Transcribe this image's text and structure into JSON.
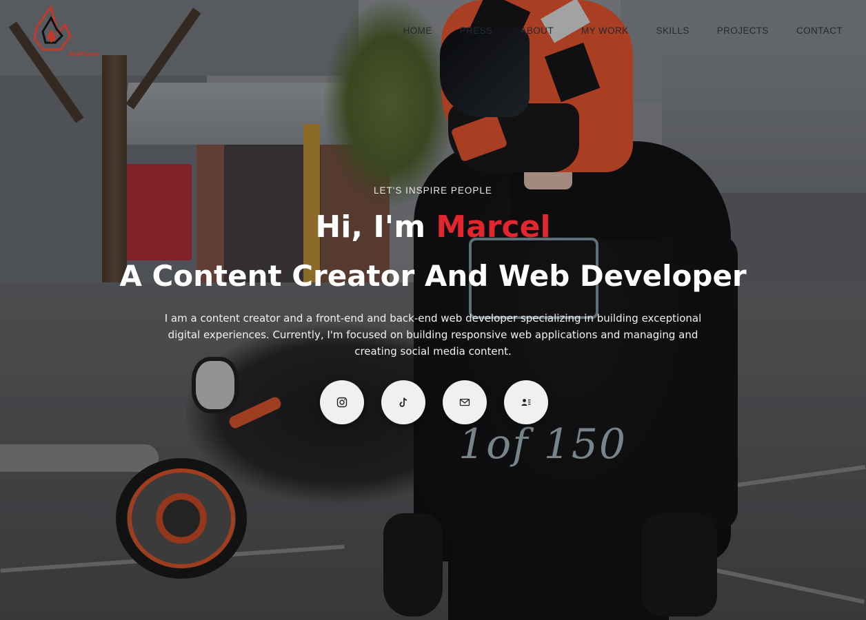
{
  "brand": {
    "logo_text": "RedFlame"
  },
  "nav": {
    "items": [
      {
        "label": "HOME"
      },
      {
        "label": "PRESS"
      },
      {
        "label": "ABOUT"
      },
      {
        "label": "MY WORK"
      },
      {
        "label": "SKILLS"
      },
      {
        "label": "PROJECTS"
      },
      {
        "label": "CONTACT"
      }
    ]
  },
  "hero": {
    "eyebrow": "LET'S INSPIRE PEOPLE",
    "greeting": "Hi, I'm ",
    "name": "Marcel",
    "role": "A Content Creator And Web Developer",
    "bio": "I am a content creator and a front-end and back-end web developer specializing in building exceptional digital experiences. Currently, I'm focused on building responsive web applications and managing and creating social media content."
  },
  "social": [
    {
      "icon": "instagram-icon"
    },
    {
      "icon": "tiktok-icon"
    },
    {
      "icon": "mail-icon"
    },
    {
      "icon": "contact-card-icon"
    }
  ],
  "colors": {
    "accent": "#e1262e",
    "button_bg": "#eef0f2",
    "text": "#ffffff"
  }
}
